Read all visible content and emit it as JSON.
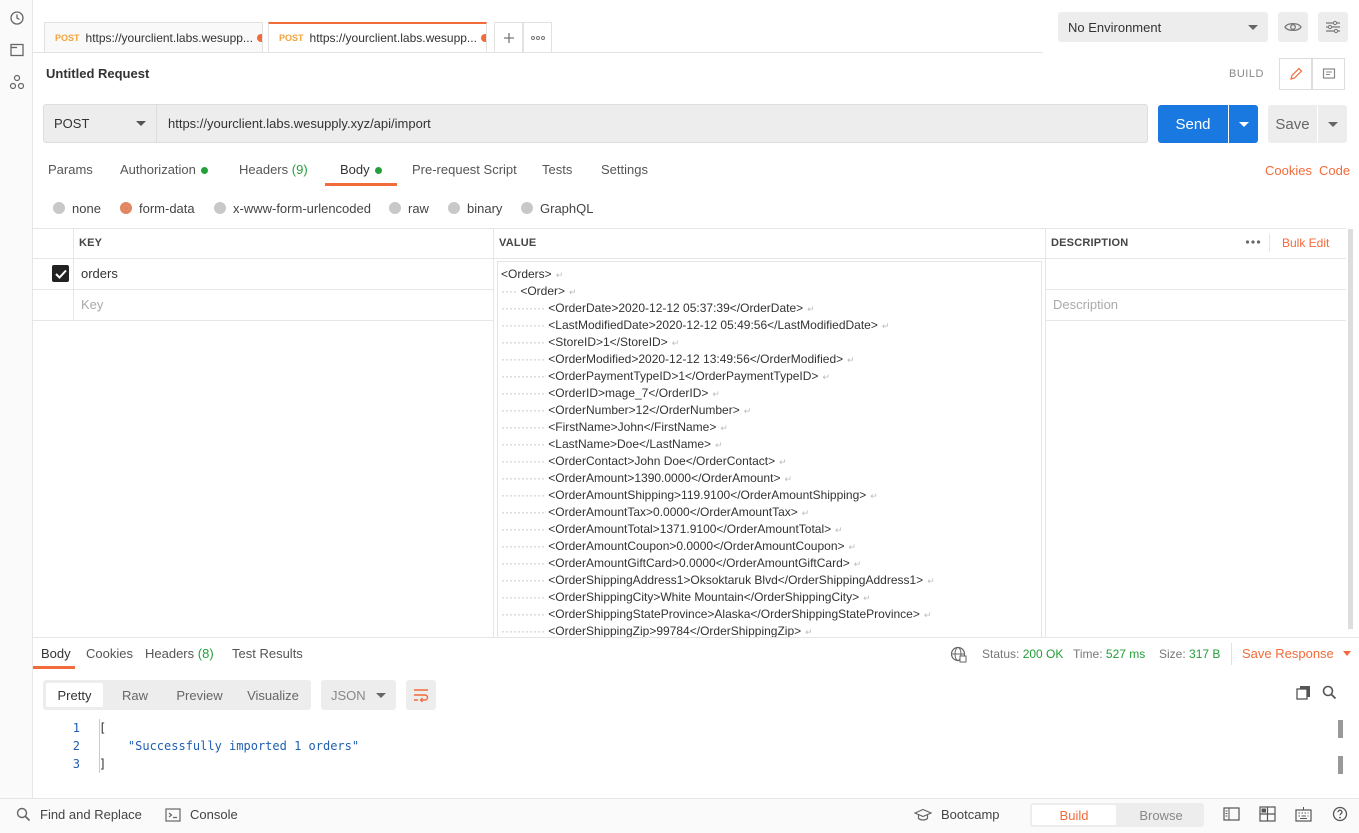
{
  "colors": {
    "accent": "#f26b3a",
    "send_blue": "#1a79e0",
    "success_green": "#23a03a",
    "method_orange": "#f2a33a"
  },
  "icons": [
    "history-icon",
    "collections-icon",
    "apis-icon",
    "plus-icon",
    "more-icon",
    "eye-icon",
    "sliders-icon",
    "pencil-icon",
    "comment-icon",
    "globe-icon",
    "copy-icon",
    "search-icon",
    "wrap-icon",
    "console-icon",
    "bootcamp-icon",
    "two-pane-icon",
    "three-pane-icon",
    "keyboard-icon",
    "help-icon"
  ],
  "tabs": [
    {
      "method": "POST",
      "title": "https://yourclient.labs.wesupp..."
    },
    {
      "method": "POST",
      "title": "https://yourclient.labs.wesupp..."
    }
  ],
  "environment": {
    "selected": "No Environment"
  },
  "request": {
    "title": "Untitled Request",
    "mode_label": "BUILD",
    "method": "POST",
    "url": "https://yourclient.labs.wesupply.xyz/api/import",
    "send_label": "Send",
    "save_label": "Save"
  },
  "request_tabs": {
    "params": "Params",
    "authorization": "Authorization",
    "headers": "Headers",
    "headers_count": "(9)",
    "body": "Body",
    "prerequest": "Pre-request Script",
    "tests": "Tests",
    "settings": "Settings",
    "cookies": "Cookies",
    "code": "Code"
  },
  "body_types": [
    "none",
    "form-data",
    "x-www-form-urlencoded",
    "raw",
    "binary",
    "GraphQL"
  ],
  "body_type_selected": "form-data",
  "form_table": {
    "headers": {
      "key": "KEY",
      "value": "VALUE",
      "description": "DESCRIPTION"
    },
    "bulk_edit": "Bulk Edit",
    "row": {
      "checked": true,
      "key": "orders"
    },
    "placeholders": {
      "key": "Key",
      "description": "Description"
    },
    "value_lines": [
      {
        "indent": 0,
        "text": "<Orders>"
      },
      {
        "indent": 1,
        "text": "<Order>"
      },
      {
        "indent": 2,
        "text": "<OrderDate>2020-12-12 05:37:39</OrderDate>"
      },
      {
        "indent": 2,
        "text": "<LastModifiedDate>2020-12-12 05:49:56</LastModifiedDate>"
      },
      {
        "indent": 2,
        "text": "<StoreID>1</StoreID>"
      },
      {
        "indent": 2,
        "text": "<OrderModified>2020-12-12 13:49:56</OrderModified>"
      },
      {
        "indent": 2,
        "text": "<OrderPaymentTypeID>1</OrderPaymentTypeID>"
      },
      {
        "indent": 2,
        "text": "<OrderID>mage_7</OrderID>"
      },
      {
        "indent": 2,
        "text": "<OrderNumber>12</OrderNumber>"
      },
      {
        "indent": 2,
        "text": "<FirstName>John</FirstName>"
      },
      {
        "indent": 2,
        "text": "<LastName>Doe</LastName>"
      },
      {
        "indent": 2,
        "text": "<OrderContact>John Doe</OrderContact>"
      },
      {
        "indent": 2,
        "text": "<OrderAmount>1390.0000</OrderAmount>"
      },
      {
        "indent": 2,
        "text": "<OrderAmountShipping>119.9100</OrderAmountShipping>"
      },
      {
        "indent": 2,
        "text": "<OrderAmountTax>0.0000</OrderAmountTax>"
      },
      {
        "indent": 2,
        "text": "<OrderAmountTotal>1371.9100</OrderAmountTotal>"
      },
      {
        "indent": 2,
        "text": "<OrderAmountCoupon>0.0000</OrderAmountCoupon>"
      },
      {
        "indent": 2,
        "text": "<OrderAmountGiftCard>0.0000</OrderAmountGiftCard>"
      },
      {
        "indent": 2,
        "text": "<OrderShippingAddress1>Oksoktaruk Blvd</OrderShippingAddress1>"
      },
      {
        "indent": 2,
        "text": "<OrderShippingCity>White Mountain</OrderShippingCity>"
      },
      {
        "indent": 2,
        "text": "<OrderShippingStateProvince>Alaska</OrderShippingStateProvince>"
      },
      {
        "indent": 2,
        "text": "<OrderShippingZip>99784</OrderShippingZip>"
      }
    ]
  },
  "response": {
    "tabs": {
      "body": "Body",
      "cookies": "Cookies",
      "headers": "Headers",
      "headers_count": "(8)",
      "test_results": "Test Results"
    },
    "status_label": "Status:",
    "status_value": "200 OK",
    "time_label": "Time:",
    "time_value": "527 ms",
    "size_label": "Size:",
    "size_value": "317 B",
    "save_response": "Save Response",
    "formats": [
      "Pretty",
      "Raw",
      "Preview",
      "Visualize"
    ],
    "format_selected": "Pretty",
    "language": "JSON",
    "code_lines": [
      {
        "n": "1",
        "text": "["
      },
      {
        "n": "2",
        "text": "    \"Successfully imported 1 orders\""
      },
      {
        "n": "3",
        "text": "]"
      }
    ]
  },
  "footer": {
    "find_replace": "Find and Replace",
    "console": "Console",
    "bootcamp": "Bootcamp",
    "build": "Build",
    "browse": "Browse"
  }
}
